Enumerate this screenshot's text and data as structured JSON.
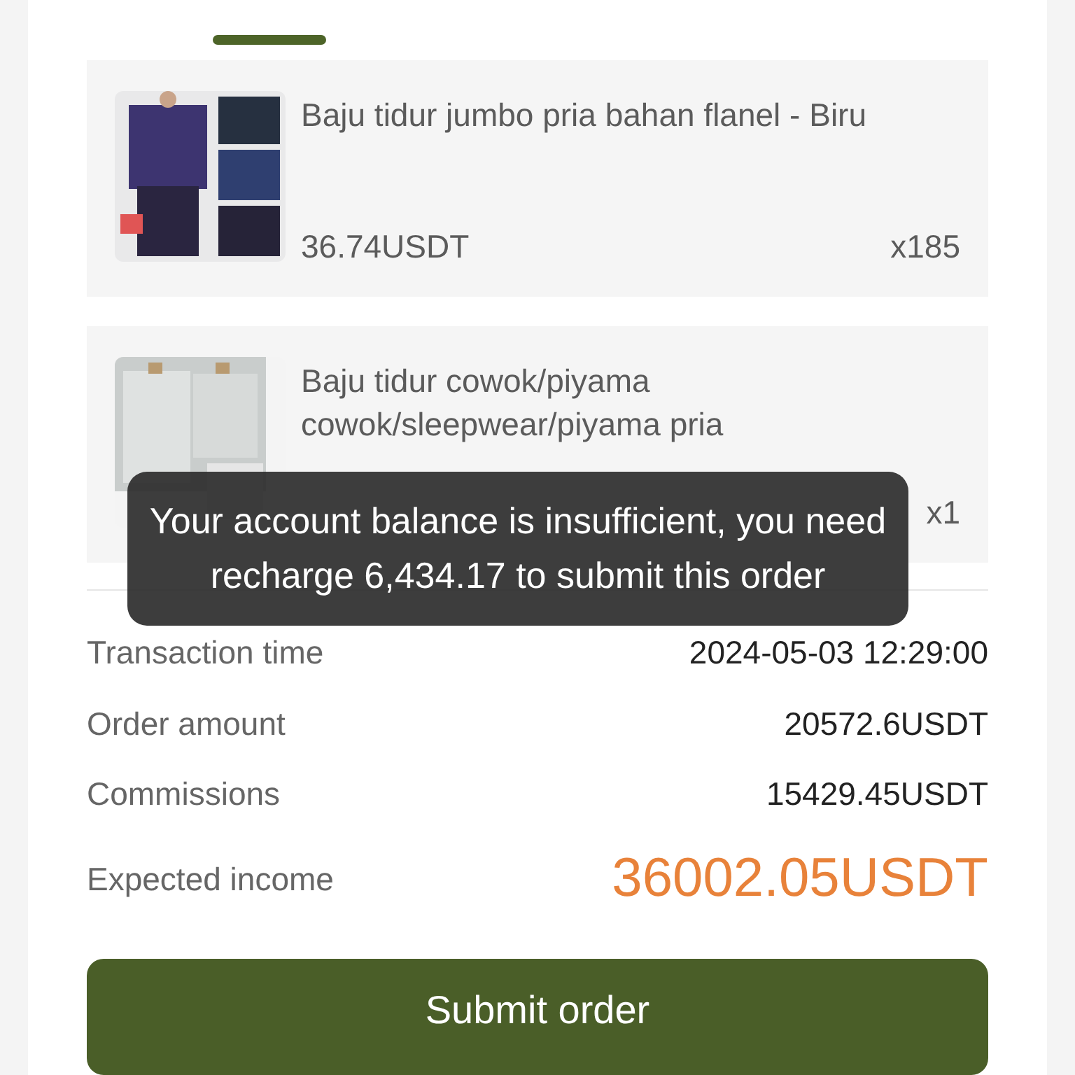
{
  "tabs": [
    {
      "selected": true
    }
  ],
  "products": [
    {
      "title": "Baju tidur jumbo pria bahan flanel - Biru",
      "price": "36.74USDT",
      "quantity": "x185"
    },
    {
      "title": "Baju tidur cowok/piyama cowok/sleepwear/piyama pria",
      "quantity": "x1"
    }
  ],
  "summary": [
    {
      "kind": "plain",
      "label": "Transaction time",
      "value": "2024-05-03 12:29:00"
    },
    {
      "kind": "plain",
      "label": "Order amount",
      "value": "20572.6USDT"
    },
    {
      "kind": "plain",
      "label": "Commissions",
      "value": "15429.45USDT"
    },
    {
      "kind": "highlight",
      "label": "Expected income",
      "value": "36002.05USDT"
    }
  ],
  "submit_button": "Submit order",
  "toast": "Your account balance is insufficient, you need recharge 6,434.17 to submit this order"
}
